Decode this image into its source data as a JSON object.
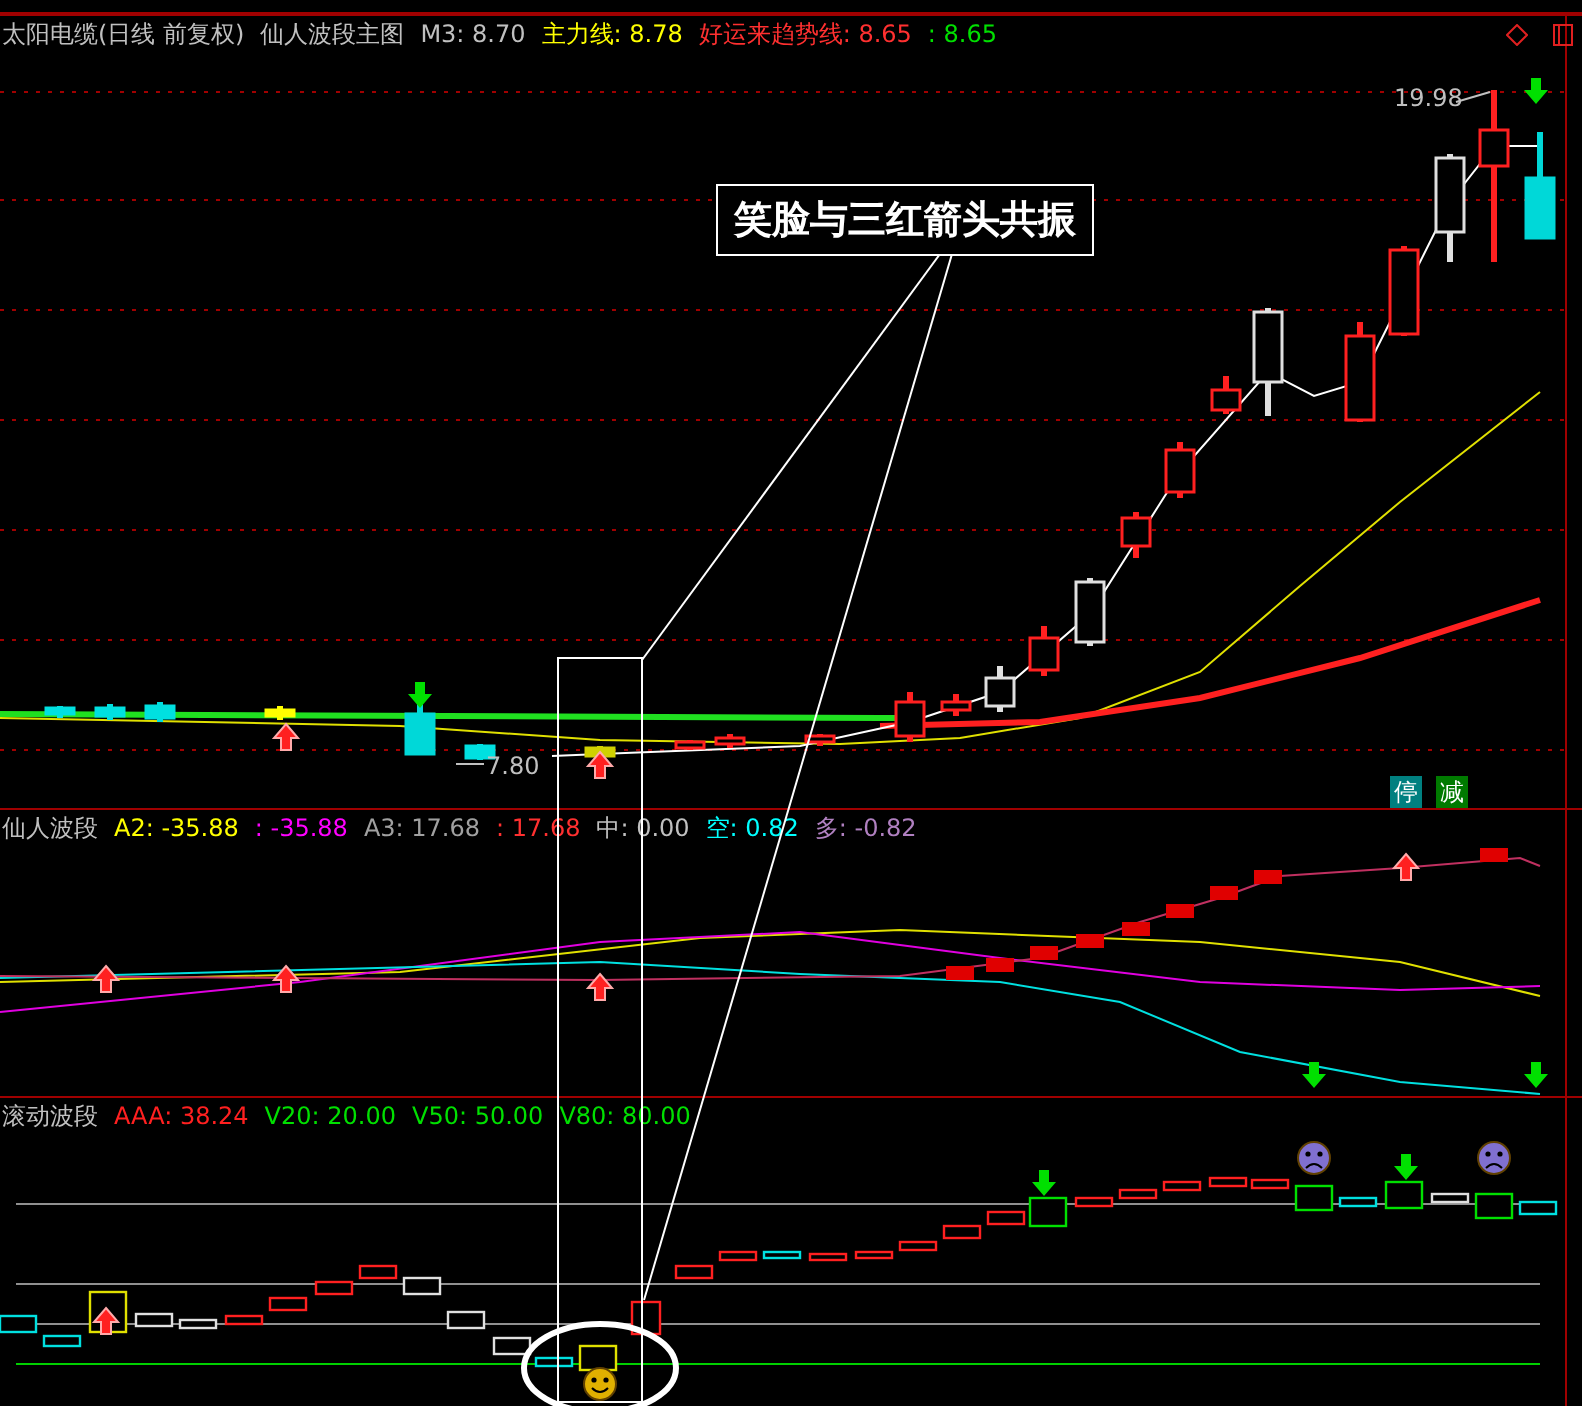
{
  "main_chart": {
    "title": "太阳电缆(日线 前复权)",
    "indicator_name": "仙人波段主图",
    "readings": [
      {
        "text": "M3: 8.70",
        "color": "#c0c0c0"
      },
      {
        "text": "主力线: 8.78",
        "color": "#ffff00"
      },
      {
        "text": "好运来趋势线: 8.65",
        "color": "#ff3030"
      },
      {
        "text": ": 8.65",
        "color": "#00e000"
      }
    ],
    "high_label": "19.98",
    "low_label": "7.80",
    "signals": [
      {
        "text": "停",
        "color": "#008080"
      },
      {
        "text": "减",
        "color": "#007a00"
      }
    ],
    "annotation": "笑脸与三红箭头共振"
  },
  "oscillator_panel": {
    "title": "仙人波段",
    "readings": [
      {
        "text": "A2: -35.88",
        "color": "#ffff00"
      },
      {
        "text": ": -35.88",
        "color": "#ff00ff"
      },
      {
        "text": "A3: 17.68",
        "color": "#a0a0a0"
      },
      {
        "text": ": 17.68",
        "color": "#ff3030"
      },
      {
        "text": "中: 0.00",
        "color": "#c0c0c0"
      },
      {
        "text": "空: 0.82",
        "color": "#00ffff"
      },
      {
        "text": "多: -0.82",
        "color": "#b080c0"
      }
    ]
  },
  "rolling_panel": {
    "title": "滚动波段",
    "readings": [
      {
        "text": "AAA: 38.24",
        "color": "#ff2020"
      },
      {
        "text": "V20: 20.00",
        "color": "#00e000"
      },
      {
        "text": "V50: 50.00",
        "color": "#00e000"
      },
      {
        "text": "V80: 80.00",
        "color": "#00e000"
      }
    ]
  }
}
